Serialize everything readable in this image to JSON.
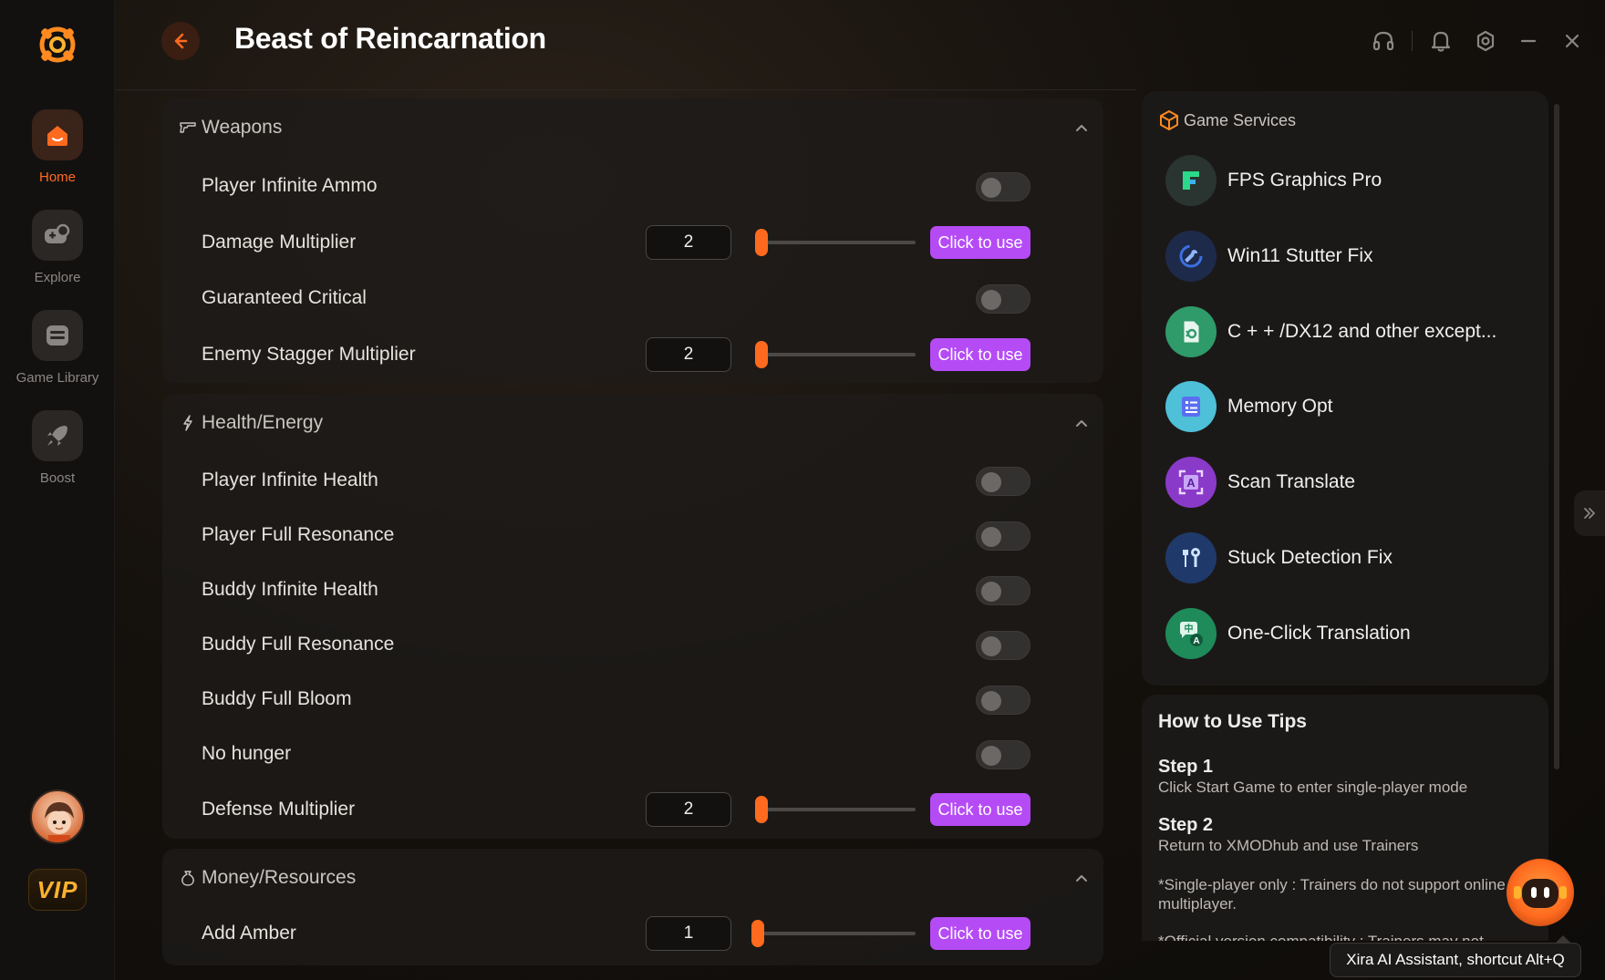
{
  "window": {
    "title": "Beast of Reincarnation"
  },
  "sidebar": {
    "items": [
      {
        "label": "Home",
        "icon": "home-icon",
        "active": true
      },
      {
        "label": "Explore",
        "icon": "gamepad-icon",
        "active": false
      },
      {
        "label": "Game Library",
        "icon": "library-icon",
        "active": false
      },
      {
        "label": "Boost",
        "icon": "rocket-icon",
        "active": false
      }
    ],
    "vip_label": "VIP"
  },
  "sections": [
    {
      "title": "Weapons",
      "icon": "gun-icon",
      "rows": [
        {
          "label": "Player Infinite Ammo",
          "type": "toggle",
          "on": false
        },
        {
          "label": "Damage Multiplier",
          "type": "slider",
          "value": "2",
          "button": "Click to use"
        },
        {
          "label": "Guaranteed Critical",
          "type": "toggle",
          "on": false
        },
        {
          "label": "Enemy Stagger Multiplier",
          "type": "slider",
          "value": "2",
          "button": "Click to use"
        }
      ]
    },
    {
      "title": "Health/Energy",
      "icon": "lightning-icon",
      "rows": [
        {
          "label": "Player Infinite Health",
          "type": "toggle",
          "on": false
        },
        {
          "label": "Player Full Resonance",
          "type": "toggle",
          "on": false
        },
        {
          "label": "Buddy Infinite Health",
          "type": "toggle",
          "on": false
        },
        {
          "label": "Buddy Full Resonance",
          "type": "toggle",
          "on": false
        },
        {
          "label": "Buddy Full Bloom",
          "type": "toggle",
          "on": false
        },
        {
          "label": "No hunger",
          "type": "toggle",
          "on": false
        },
        {
          "label": "Defense Multiplier",
          "type": "slider",
          "value": "2",
          "button": "Click to use"
        }
      ]
    },
    {
      "title": "Money/Resources",
      "icon": "money-bag-icon",
      "rows": [
        {
          "label": "Add Amber",
          "type": "slider",
          "value": "1",
          "button": "Click to use"
        }
      ]
    }
  ],
  "services": {
    "title": "Game Services",
    "items": [
      {
        "label": "FPS Graphics Pro",
        "icon": "fps-icon",
        "color": "#2bd98a"
      },
      {
        "label": "Win11 Stutter Fix",
        "icon": "wrench-icon",
        "color": "#3b6fe0"
      },
      {
        "label": "C + + /DX12 and other except...",
        "icon": "file-repair-icon",
        "color": "#2f9a6a"
      },
      {
        "label": "Memory Opt",
        "icon": "memory-icon",
        "color": "#5a6ff0"
      },
      {
        "label": "Scan Translate",
        "icon": "scan-translate-icon",
        "color": "#a64ad8"
      },
      {
        "label": "Stuck Detection Fix",
        "icon": "tools-icon",
        "color": "#3a7ad8"
      },
      {
        "label": "One-Click Translation",
        "icon": "translate-chat-icon",
        "color": "#22a86a"
      }
    ]
  },
  "tips": {
    "title": "How to Use Tips",
    "steps": [
      {
        "head": "Step 1",
        "text": "Click Start Game to enter single-player mode"
      },
      {
        "head": "Step 2",
        "text": "Return to XMODhub and use Trainers"
      }
    ],
    "notes": [
      "*Single-player only : Trainers do not support online multiplayer.",
      "*Official version compatibility : Trainers may not"
    ]
  },
  "assistant": {
    "tooltip": "Xira AI Assistant, shortcut Alt+Q"
  },
  "colors": {
    "accent": "#ff6a1f",
    "button": "#b54bf5"
  }
}
